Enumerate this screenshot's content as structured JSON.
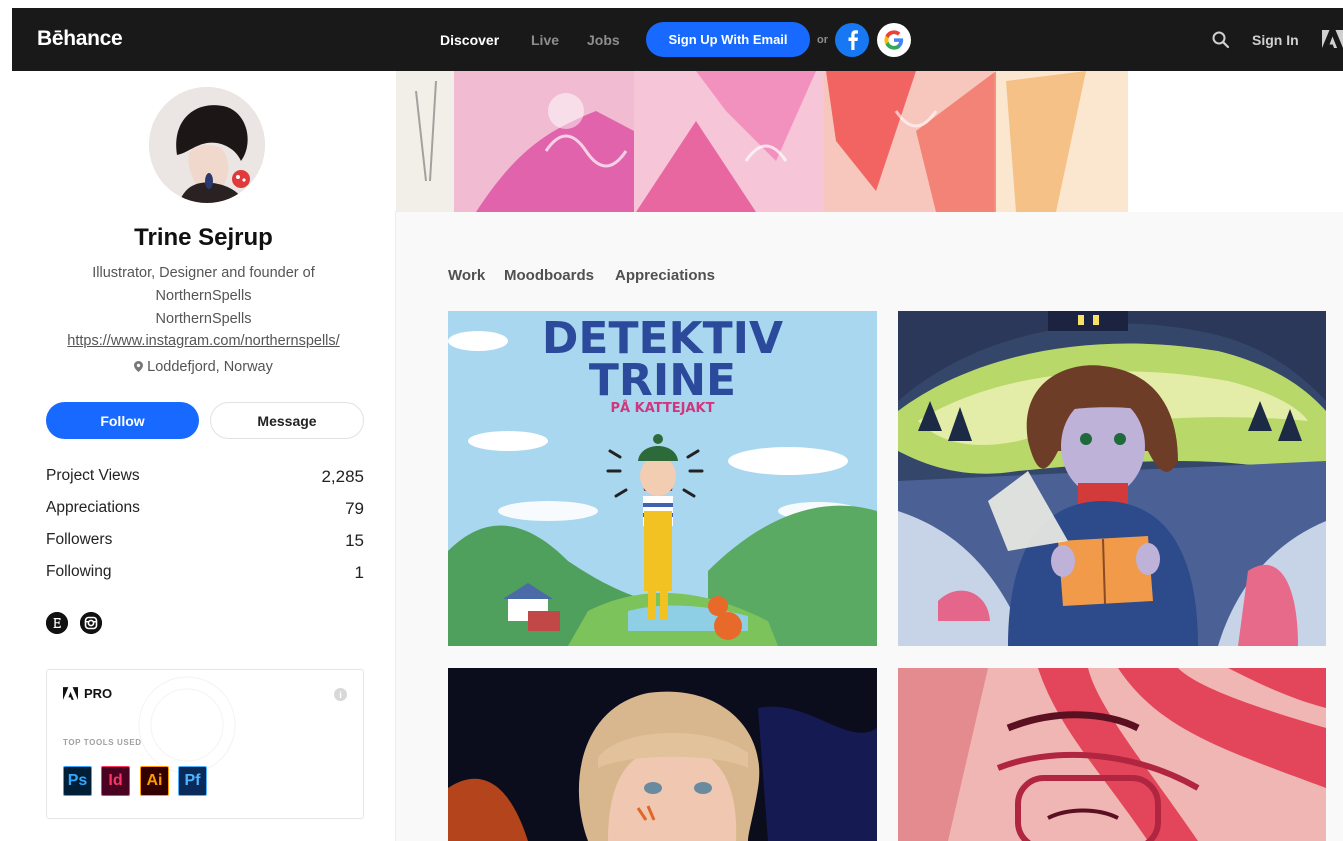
{
  "header": {
    "logo": "Bēhance",
    "nav": [
      "Discover",
      "Live",
      "Jobs"
    ],
    "signup_label": "Sign Up With Email",
    "or_label": "or",
    "signin_label": "Sign In"
  },
  "profile": {
    "name": "Trine Sejrup",
    "bio_line1": "Illustrator, Designer and founder of",
    "bio_line2": "NorthernSpells",
    "company": "NorthernSpells",
    "link": "https://www.instagram.com/northernspells/",
    "location": "Loddefjord, Norway",
    "follow_label": "Follow",
    "message_label": "Message",
    "stats": [
      {
        "label": "Project Views",
        "value": "2,285"
      },
      {
        "label": "Appreciations",
        "value": "79"
      },
      {
        "label": "Followers",
        "value": "15"
      },
      {
        "label": "Following",
        "value": "1"
      }
    ],
    "social_icons": [
      "etsy-icon",
      "instagram-icon"
    ]
  },
  "pro": {
    "badge": "PRO",
    "info": "i",
    "tools_label": "TOP TOOLS USED",
    "tools": [
      {
        "abbr": "Ps",
        "bg": "#001e36",
        "fg": "#31a8ff"
      },
      {
        "abbr": "Id",
        "bg": "#49021f",
        "fg": "#ff3366"
      },
      {
        "abbr": "Ai",
        "bg": "#330000",
        "fg": "#ff9a00"
      },
      {
        "abbr": "Pf",
        "bg": "#0a2a5a",
        "fg": "#4fb4ff"
      }
    ]
  },
  "tabs": [
    "Work",
    "Moodboards",
    "Appreciations"
  ],
  "projects": [
    {
      "title_line1": "DETEKTIV",
      "title_line2": "TRINE",
      "subtitle": "PÅ KATTEJAKT"
    }
  ],
  "colors": {
    "accent": "#1769ff",
    "header_bg": "#191919",
    "content_bg": "#f9f9f9"
  }
}
